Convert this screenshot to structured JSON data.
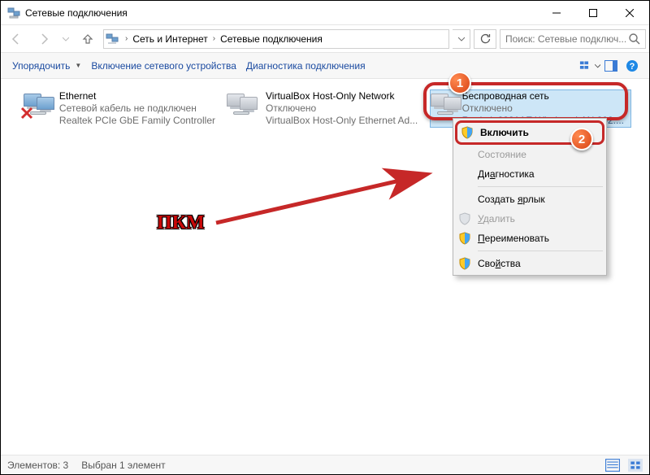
{
  "window": {
    "title": "Сетевые подключения"
  },
  "nav": {
    "breadcrumb": [
      "Сеть и Интернет",
      "Сетевые подключения"
    ],
    "search_placeholder": "Поиск: Сетевые подключ..."
  },
  "toolbar": {
    "organize": "Упорядочить",
    "enable_device": "Включение сетевого устройства",
    "diagnose": "Диагностика подключения"
  },
  "adapters": [
    {
      "name": "Ethernet",
      "status": "Сетевой кабель не подключен",
      "device": "Realtek PCIe GbE Family Controller",
      "state": "unplugged"
    },
    {
      "name": "VirtualBox Host-Only Network",
      "status": "Отключено",
      "device": "VirtualBox Host-Only Ethernet Ad...",
      "state": "disabled"
    },
    {
      "name": "Беспроводная сеть",
      "status": "Отключено",
      "device": "Realtek 8821AE Wireless LAN 802....",
      "state": "disabled"
    }
  ],
  "context_menu": {
    "enable": "Включить",
    "status": "Состояние",
    "diagnose": "Диагностика",
    "shortcut": "Создать ярлык",
    "delete": "Удалить",
    "rename": "Переименовать",
    "properties": "Свойства"
  },
  "annotation": {
    "label": "ПКМ",
    "badge1": "1",
    "badge2": "2"
  },
  "statusbar": {
    "items": "Элементов: 3",
    "selected": "Выбран 1 элемент"
  }
}
